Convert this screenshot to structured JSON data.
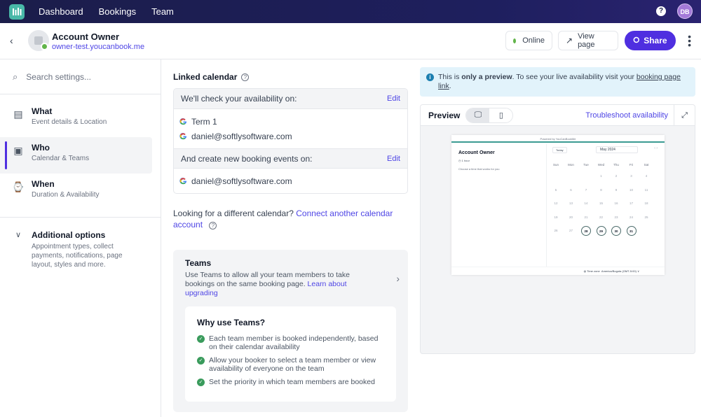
{
  "topnav": {
    "items": [
      "Dashboard",
      "Bookings",
      "Team"
    ],
    "help": "?",
    "avatar": "DB"
  },
  "header": {
    "owner_name": "Account Owner",
    "owner_url": "owner-test.youcanbook.me",
    "online_label": "Online",
    "view_page_label": "View page",
    "share_label": "Share"
  },
  "sidebar": {
    "search_placeholder": "Search settings...",
    "items": [
      {
        "title": "What",
        "subtitle": "Event details & Location"
      },
      {
        "title": "Who",
        "subtitle": "Calendar & Teams"
      },
      {
        "title": "When",
        "subtitle": "Duration & Availability"
      }
    ],
    "additional": {
      "title": "Additional options",
      "subtitle": "Appointment types, collect payments, notifications, page layout, styles and more."
    }
  },
  "main": {
    "linked_calendar_title": "Linked calendar",
    "check_label": "We'll check your availability on:",
    "edit_label": "Edit",
    "check_calendars": [
      "Term 1",
      "daniel@softlysoftware.com"
    ],
    "create_label": "And create new booking events on:",
    "create_calendars": [
      "daniel@softlysoftware.com"
    ],
    "different_text": "Looking for a different calendar?",
    "connect_link": "Connect another calendar account",
    "teams": {
      "title": "Teams",
      "description": "Use Teams to allow all your team members to take bookings on the same booking page.",
      "learn_link": "Learn about upgrading",
      "why_title": "Why use Teams?",
      "reasons": [
        "Each team member is booked independently, based on their calendar availability",
        "Allow your booker to select a team member or view availability of everyone on the team",
        "Set the priority in which team members are booked"
      ]
    }
  },
  "preview": {
    "notice_prefix": "This is",
    "notice_bold": "only a preview",
    "notice_mid": ". To see your live availability visit your",
    "notice_link": "booking page link",
    "notice_end": ".",
    "label": "Preview",
    "troubleshoot": "Troubleshoot availability",
    "mini": {
      "powered": "Powered by YouCanBookMe",
      "title": "Account Owner",
      "duration": "1 hour",
      "choose": "Choose a time that works for you",
      "today": "Today",
      "month": "May 2024",
      "weekdays": [
        "Sun",
        "Mon",
        "Tue",
        "Wed",
        "Thu",
        "Fri",
        "Sat"
      ],
      "weeks": [
        [
          "",
          "",
          "",
          "1",
          "2",
          "3",
          "4"
        ],
        [
          "5",
          "6",
          "7",
          "8",
          "9",
          "10",
          "11"
        ],
        [
          "12",
          "13",
          "14",
          "15",
          "16",
          "17",
          "18"
        ],
        [
          "19",
          "20",
          "21",
          "22",
          "23",
          "24",
          "25"
        ],
        [
          "26",
          "27",
          "28",
          "29",
          "30",
          "31",
          ""
        ]
      ],
      "available": [
        "28",
        "29",
        "30",
        "31"
      ],
      "timezone_label": "Time zone",
      "timezone": "America/Bogota (GMT-5:00)"
    }
  },
  "colors": {
    "accent": "#4f2fe0",
    "link": "#4f46e5",
    "online": "#62b54a",
    "teal": "#3a9b92"
  }
}
